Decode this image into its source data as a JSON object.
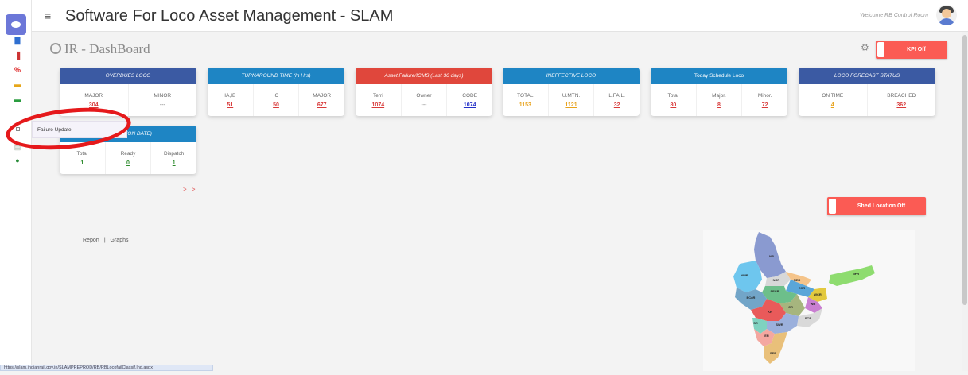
{
  "app": {
    "title": "Software For Loco Asset Management - SLAM",
    "welcome": "Welcome RB Control Room"
  },
  "dashboard": {
    "title": "IR - DashBoard"
  },
  "toggles": {
    "kpi": "KPI Off",
    "shed": "Shed Location Off"
  },
  "popup": {
    "label": "Failure Update"
  },
  "links": {
    "report": "Report",
    "separator": "|",
    "graphs": "Graphs",
    "more": "> >"
  },
  "status_url": "https://slam.indianrail.gov.in/SLAMPREPROD/RB/RBLocofailClassif.lnd.aspx",
  "colors": {
    "navy": "#3b5aa3",
    "blue": "#1e85c4",
    "red": "#e0473c",
    "toggle": "#fb5b54"
  },
  "cards": [
    {
      "title": "OVERDUES LOCO",
      "cols": [
        {
          "k": "MAJOR",
          "v": "304"
        },
        {
          "k": "MINOR",
          "v": "---"
        }
      ]
    },
    {
      "title": "TURNAROUND TIME (In Hrs)",
      "cols": [
        {
          "k": "IA,IB",
          "v": "51"
        },
        {
          "k": "IC",
          "v": "50"
        },
        {
          "k": "MAJOR",
          "v": "677"
        }
      ]
    },
    {
      "title": "Asset Failure/ICMS (Last 30 days)",
      "cols": [
        {
          "k": "Terri",
          "v": "1074"
        },
        {
          "k": "Owner",
          "v": "---"
        },
        {
          "k": "CODE",
          "v": "1074"
        }
      ]
    },
    {
      "title": "INEFFECTIVE LOCO",
      "cols": [
        {
          "k": "TOTAL",
          "v": "1153"
        },
        {
          "k": "U.MTN.",
          "v": "1121"
        },
        {
          "k": "L.FAIL.",
          "v": "32"
        }
      ]
    },
    {
      "title": "Today Schedule Loco",
      "cols": [
        {
          "k": "Total",
          "v": "80"
        },
        {
          "k": "Major.",
          "v": "8"
        },
        {
          "k": "Minor.",
          "v": "72"
        }
      ]
    },
    {
      "title": "LOCO FORECAST STATUS",
      "cols": [
        {
          "k": "ON TIME",
          "v": "4"
        },
        {
          "k": "BREACHED",
          "v": "362"
        }
      ]
    },
    {
      "title": "SPATCH (ON DATE)",
      "cols": [
        {
          "k": "Total",
          "v": "1"
        },
        {
          "k": "Ready",
          "v": "0"
        },
        {
          "k": "Dispatch",
          "v": "1"
        }
      ]
    }
  ],
  "map_regions": [
    "NR",
    "NWR",
    "NCR",
    "NER",
    "NFR",
    "ECR",
    "WCR",
    "WR",
    "SECR",
    "ECoR",
    "CR",
    "SCR",
    "KR",
    "SWR",
    "SR",
    "ER",
    "SER",
    "NCR"
  ]
}
